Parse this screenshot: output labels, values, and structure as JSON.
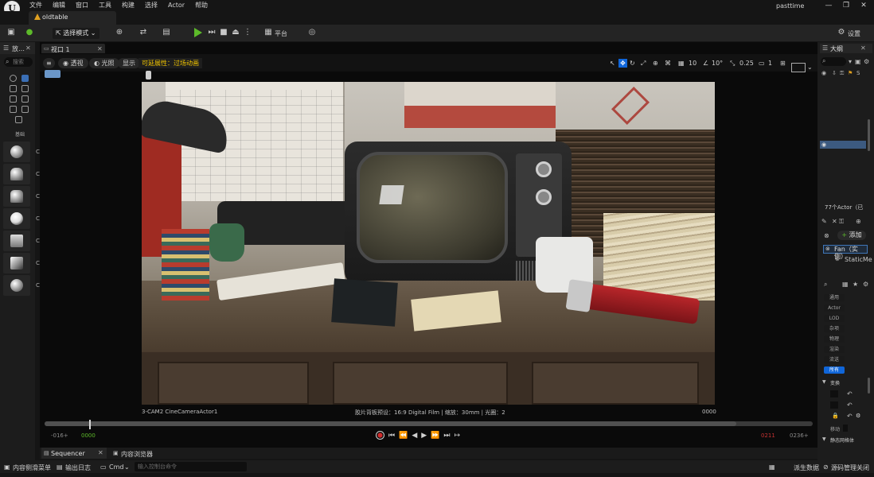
{
  "app": {
    "logo": "U",
    "project_name": "pasttime",
    "menu": [
      "文件",
      "编辑",
      "窗口",
      "工具",
      "构建",
      "选择",
      "Actor",
      "帮助"
    ],
    "window_controls": [
      "—",
      "❐",
      "✕"
    ]
  },
  "document_tab": {
    "label": "oldtable",
    "icon": "level-icon"
  },
  "toolbar": {
    "mode_label": "选择模式",
    "platform_label": "平台",
    "settings_label": "设置"
  },
  "left_panel": {
    "tab_label": "放…",
    "search_placeholder": "搜索",
    "basic_label": "基础",
    "items": [
      "C",
      "C",
      "C",
      "C",
      "C",
      "C",
      "C"
    ]
  },
  "viewport": {
    "tab_label": "视口 1",
    "view_mode": "透视",
    "lit_mode": "光照",
    "show_label": "显示",
    "performance_label": "可延展性：过场动画",
    "grid_snap": "10",
    "rotation_snap": "10°",
    "scale_snap": "0.25",
    "camera_speed": "1",
    "camera_label": "3-CAM2  CineCameraActor1",
    "film_info": "胶片背板预设：16:9 Digital Film | 缩放：30mm | 光圈：2",
    "frame_right": "0000"
  },
  "timeline": {
    "start": "-016+",
    "current": "0000",
    "end_red": "0211",
    "end": "0236+",
    "progress": 0.9
  },
  "bottom_tabs": {
    "sequencer": "Sequencer",
    "content_browser": "内容浏览器"
  },
  "statusbar": {
    "content_drawer": "内容侧滑菜单",
    "output_log": "输出日志",
    "cmd": "Cmd",
    "cmd_placeholder": "输入控制台命令",
    "derived_data": "派生数据",
    "source_control": "源码管理关闭"
  },
  "right_panel": {
    "outliner_tab": "大纲",
    "outliner_column": "S",
    "actor_count": "77个Actor（已",
    "add_label": "添加",
    "fan_row": "Fan（实例）",
    "static_row": "StaticMe",
    "prop_filters": [
      "通用",
      "Actor",
      "LOD",
      "杂项",
      "物理",
      "渲染",
      "流送",
      "所有"
    ],
    "transform_label": "变换",
    "mobility_label": "移动",
    "mesh_label": "静态网格体"
  },
  "colors": {
    "accent_blue": "#1066d9",
    "play_green": "#5dba2a",
    "perf_yellow": "#f2c500",
    "record_red": "#d02c2c"
  }
}
